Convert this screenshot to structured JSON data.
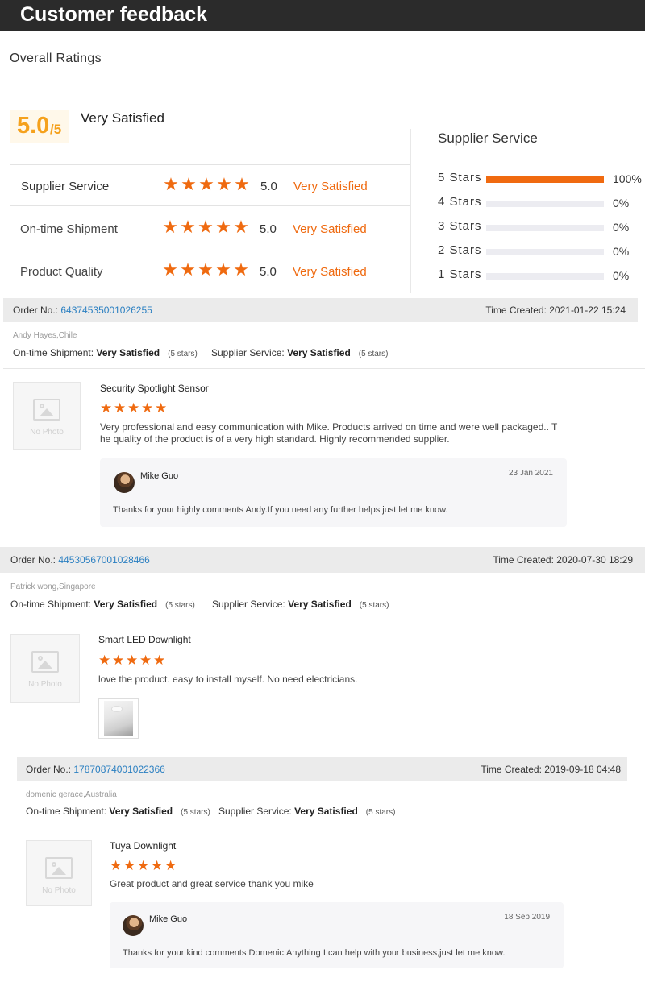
{
  "header": {
    "title": "Customer feedback"
  },
  "overall": {
    "section_title": "Overall Ratings",
    "score": "5.0",
    "score_denominator": "/5",
    "score_text": "Very Satisfied",
    "rows": [
      {
        "label": "Supplier Service",
        "score": "5.0",
        "text": "Very Satisfied",
        "stars": 5
      },
      {
        "label": "On-time Shipment",
        "score": "5.0",
        "text": "Very Satisfied",
        "stars": 5
      },
      {
        "label": "Product Quality",
        "score": "5.0",
        "text": "Very Satisfied",
        "stars": 5
      }
    ]
  },
  "distribution": {
    "title": "Supplier Service",
    "rows": [
      {
        "label": "5  Stars",
        "percent": "100%",
        "fraction": 1.0
      },
      {
        "label": "4  Stars",
        "percent": "0%",
        "fraction": 0
      },
      {
        "label": "3  Stars",
        "percent": "0%",
        "fraction": 0
      },
      {
        "label": "2  Stars",
        "percent": "0%",
        "fraction": 0
      },
      {
        "label": "1  Stars",
        "percent": "0%",
        "fraction": 0
      }
    ],
    "accent_color": "#f06a10"
  },
  "orders": [
    {
      "order_label": "Order No.:",
      "order_no": "64374535001026255",
      "time_created": "Time Created: 2021-01-22 15:24",
      "buyer": "Andy Hayes,Chile",
      "shipment_label": "On-time Shipment:",
      "shipment_value": "Very Satisfied",
      "shipment_stars": "(5 stars)",
      "service_label": "Supplier Service:",
      "service_value": "Very Satisfied",
      "service_stars": "(5 stars)",
      "no_photo": "No Photo",
      "product": "Security Spotlight Sensor",
      "stars": 5,
      "comment_line1": "Very professional and easy communication with Mike. Products arrived on time and were well packaged.. T",
      "comment_line2": "he quality of the product is of a very high standard. Highly recommended supplier.",
      "reply": {
        "name": "Mike Guo",
        "date": "23 Jan 2021",
        "text": "Thanks for your highly comments Andy.If you need any further helps just let me know."
      }
    },
    {
      "order_label": "Order No.:",
      "order_no": "44530567001028466",
      "time_created": "Time Created: 2020-07-30 18:29",
      "buyer": "Patrick wong,Singapore",
      "shipment_label": "On-time Shipment:",
      "shipment_value": "Very Satisfied",
      "shipment_stars": "(5 stars)",
      "service_label": "Supplier Service:",
      "service_value": "Very Satisfied",
      "service_stars": "(5 stars)",
      "no_photo": "No Photo",
      "product": "Smart LED Downlight",
      "stars": 5,
      "comment_line1": "love the product. easy to install myself. No need electricians."
    },
    {
      "order_label": "Order No.:",
      "order_no": "17870874001022366",
      "time_created": "Time Created: 2019-09-18 04:48",
      "buyer": "domenic gerace,Australia",
      "shipment_label": "On-time Shipment:",
      "shipment_value": "Very Satisfied",
      "shipment_stars": "(5 stars)",
      "service_label": "Supplier Service:",
      "service_value": "Very Satisfied",
      "service_stars": "(5 stars)",
      "no_photo": "No Photo",
      "product": "Tuya Downlight",
      "stars": 5,
      "comment_line1": "Great product and great service thank you mike",
      "reply": {
        "name": "Mike Guo",
        "date": "18 Sep 2019",
        "text": "Thanks for your kind comments Domenic.Anything I can help with your business,just let me know."
      }
    }
  ]
}
